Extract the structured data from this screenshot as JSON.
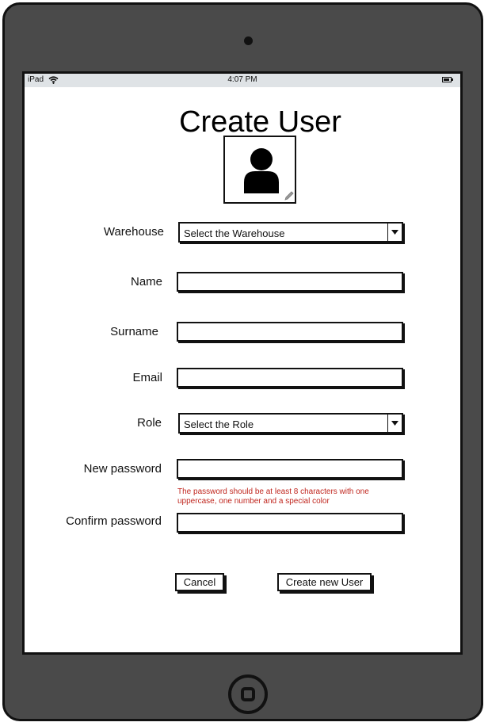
{
  "status_bar": {
    "carrier": "iPad",
    "time": "4:07 PM"
  },
  "form": {
    "title": "Create User",
    "warehouse": {
      "label": "Warehouse",
      "value": "Select the Warehouse"
    },
    "name": {
      "label": "Name",
      "value": ""
    },
    "surname": {
      "label": "Surname",
      "value": ""
    },
    "email": {
      "label": "Email",
      "value": ""
    },
    "role": {
      "label": "Role",
      "value": "Select the Role"
    },
    "new_password": {
      "label": "New password",
      "value": "",
      "hint": "The password should be at least 8 characters with one uppercase, one number and a special color"
    },
    "confirm_password": {
      "label": "Confirm password",
      "value": ""
    }
  },
  "actions": {
    "cancel_label": "Cancel",
    "create_label": "Create new User"
  },
  "colors": {
    "hint": "#c0261e",
    "status_bar": "#dfe3e6",
    "device": "#4a4a4a"
  }
}
